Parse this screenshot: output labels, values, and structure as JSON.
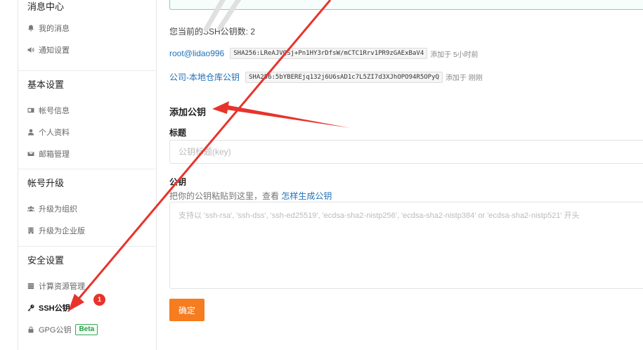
{
  "sidebar": {
    "groups": [
      {
        "title": "消息中心",
        "items": [
          {
            "label": "我的消息",
            "icon": "bell-icon"
          },
          {
            "label": "通知设置",
            "icon": "speaker-icon"
          }
        ]
      },
      {
        "title": "基本设置",
        "items": [
          {
            "label": "帐号信息",
            "icon": "id-card-icon"
          },
          {
            "label": "个人资料",
            "icon": "user-icon"
          },
          {
            "label": "邮箱管理",
            "icon": "envelope-icon"
          }
        ]
      },
      {
        "title": "帐号升级",
        "items": [
          {
            "label": "升级为组织",
            "icon": "users-icon"
          },
          {
            "label": "升级为企业版",
            "icon": "building-icon"
          }
        ]
      },
      {
        "title": "安全设置",
        "items": [
          {
            "label": "计算资源管理",
            "icon": "server-icon"
          },
          {
            "label": "SSH公钥",
            "icon": "key-icon",
            "active": true
          },
          {
            "label": "GPG公钥",
            "icon": "lock-icon",
            "badge": "Beta"
          }
        ]
      }
    ]
  },
  "main": {
    "key_count_text": "您当前的SSH公钥数: 2",
    "keys": [
      {
        "name": "root@lidao996",
        "fingerprint": "SHA256:LReAJVQSj+Pn1HY3rDfsW/mCTC1Rrv1PR9zGAExBaV4",
        "added": "添加于 5小时前"
      },
      {
        "name": "公司-本地仓库公钥",
        "fingerprint": "SHA256:5bYBEREjq132j6U6sAD1c7L5ZI7d3XJhOPO94R5OPyQ",
        "added": "添加于 刚刚"
      }
    ],
    "add_section_title": "添加公钥",
    "title_label": "标题",
    "title_placeholder": "公钥标题(key)",
    "key_label": "公钥",
    "hint_text": "把你的公钥粘贴到这里，查看 ",
    "hint_link": "怎样生成公钥",
    "key_placeholder": "支持以 'ssh-rsa', 'ssh-dss', 'ssh-ed25519', 'ecdsa-sha2-nistp256', 'ecdsa-sha2-nistp384' or 'ecdsa-sha2-nistp521' 开头",
    "submit_label": "确定"
  },
  "annotations": {
    "step_number": "1",
    "arrow_color": "#e8332c"
  }
}
